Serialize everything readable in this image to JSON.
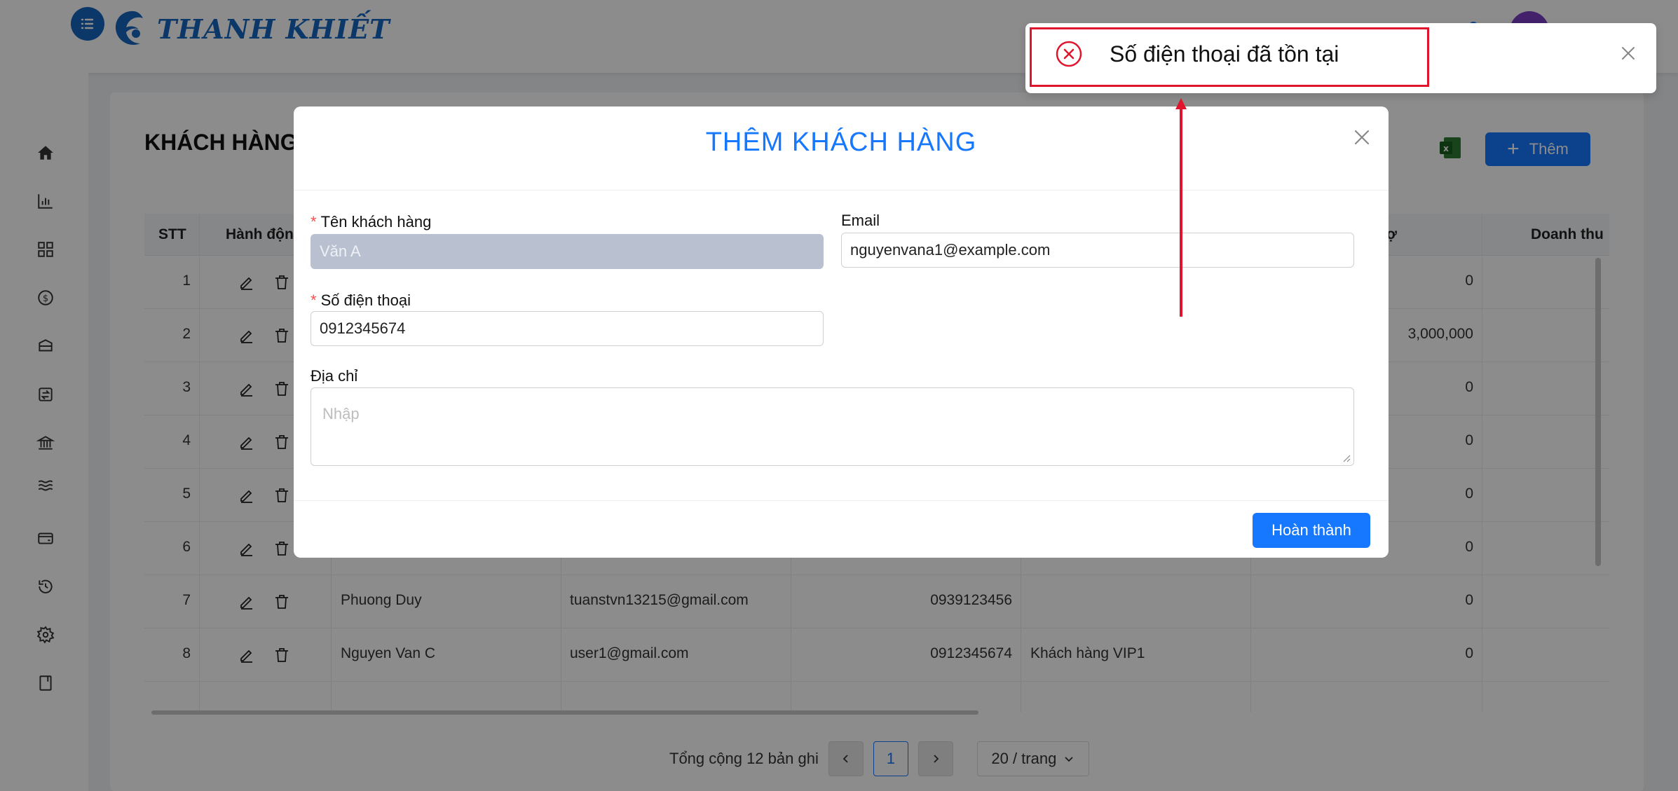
{
  "app": {
    "brand": "THANH KHIẾT",
    "colors": {
      "primary": "#1677ff",
      "brand": "#1565c0",
      "danger": "#e0142c"
    }
  },
  "sidebar": {
    "items": [
      {
        "icon": "home-icon"
      },
      {
        "icon": "bar-chart-icon"
      },
      {
        "icon": "grid-icon"
      },
      {
        "icon": "dollar-icon"
      },
      {
        "icon": "box-icon"
      },
      {
        "icon": "transfer-icon"
      },
      {
        "icon": "bank-icon"
      },
      {
        "icon": "waves-icon"
      },
      {
        "icon": "wallet-icon"
      },
      {
        "icon": "history-icon"
      },
      {
        "icon": "settings-icon"
      },
      {
        "icon": "book-icon"
      }
    ]
  },
  "page": {
    "title": "KHÁCH HÀNG",
    "add_label": "Thêm"
  },
  "table": {
    "headers": {
      "stt": "STT",
      "actions": "Hành động",
      "debt": "ợ",
      "revenue": "Doanh thu"
    },
    "rows": [
      {
        "stt": "1",
        "name": "",
        "email": "",
        "phone": "",
        "group": "",
        "amount": "0"
      },
      {
        "stt": "2",
        "name": "",
        "email": "",
        "phone": "",
        "group": "",
        "amount": "3,000,000"
      },
      {
        "stt": "3",
        "name": "",
        "email": "",
        "phone": "",
        "group": "",
        "amount": "0"
      },
      {
        "stt": "4",
        "name": "",
        "email": "",
        "phone": "",
        "group": "",
        "amount": "0"
      },
      {
        "stt": "5",
        "name": "",
        "email": "",
        "phone": "",
        "group": "",
        "amount": "0"
      },
      {
        "stt": "6",
        "name": "",
        "email": "",
        "phone": "",
        "group": "",
        "amount": "0"
      },
      {
        "stt": "7",
        "name": "Phuong Duy",
        "email": "tuanstvn13215@gmail.com",
        "phone": "0939123456",
        "group": "",
        "amount": "0"
      },
      {
        "stt": "8",
        "name": "Nguyen Van C",
        "email": "user1@gmail.com",
        "phone": "0912345674",
        "group": "Khách hàng VIP1",
        "amount": "0"
      }
    ]
  },
  "pagination": {
    "total_label": "Tổng cộng 12 bản ghi",
    "current_page": "1",
    "page_size_label": "20 / trang"
  },
  "modal": {
    "title": "THÊM KHÁCH HÀNG",
    "name_label": "Tên khách hàng",
    "name_value": "Văn A",
    "email_label": "Email",
    "email_value": "nguyenvana1@example.com",
    "phone_label": "Số điện thoại",
    "phone_value": "0912345674",
    "address_label": "Địa chỉ",
    "address_placeholder": "Nhập",
    "required_mark": "*",
    "submit_label": "Hoàn thành"
  },
  "toast": {
    "message": "Số điện thoại đã tồn tại",
    "type": "error"
  }
}
